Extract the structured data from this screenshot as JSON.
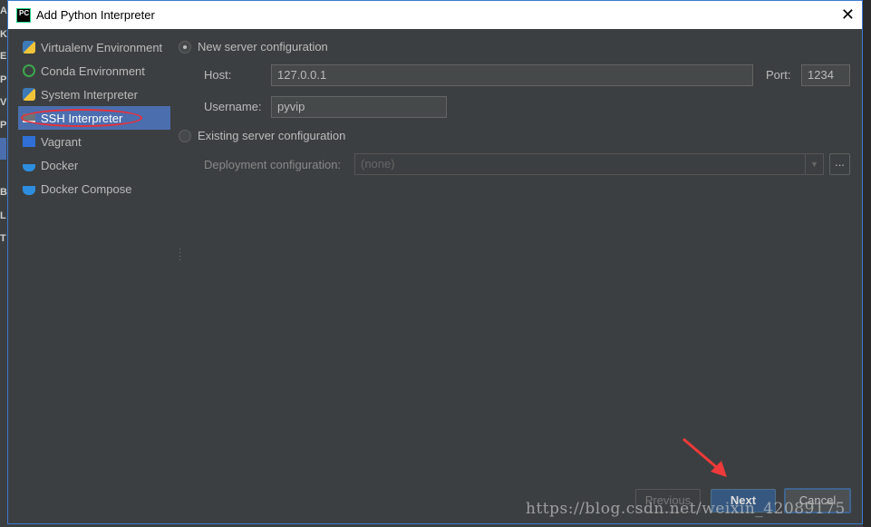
{
  "background_ide": {
    "letters": [
      "A",
      "K",
      "E",
      "P",
      "V",
      "P",
      "B",
      "L",
      "T"
    ]
  },
  "dialog": {
    "title": "Add Python Interpreter",
    "logo_text": "PC"
  },
  "sidebar": {
    "items": [
      {
        "label": "Virtualenv Environment",
        "icon": "python-virtualenv-icon"
      },
      {
        "label": "Conda Environment",
        "icon": "conda-icon"
      },
      {
        "label": "System Interpreter",
        "icon": "python-icon"
      },
      {
        "label": "SSH Interpreter",
        "icon": "ssh-terminal-icon",
        "selected": true
      },
      {
        "label": "Vagrant",
        "icon": "vagrant-icon"
      },
      {
        "label": "Docker",
        "icon": "docker-icon"
      },
      {
        "label": "Docker Compose",
        "icon": "docker-compose-icon"
      }
    ]
  },
  "form": {
    "new_server": "New server configuration",
    "host_label": "Host:",
    "host_value": "127.0.0.1",
    "port_label": "Port:",
    "port_value": "1234",
    "username_label": "Username:",
    "username_value": "pyvip",
    "existing_server": "Existing server configuration",
    "deployment_label": "Deployment configuration:",
    "deployment_value": "(none)",
    "browse": "..."
  },
  "buttons": {
    "previous": "Previous",
    "next": "Next",
    "cancel": "Cancel"
  },
  "watermark": "https://blog.csdn.net/weixin_42089175",
  "colors": {
    "selection": "#4b6eaf",
    "annotation": "#e8303a",
    "background": "#3c3f41"
  }
}
